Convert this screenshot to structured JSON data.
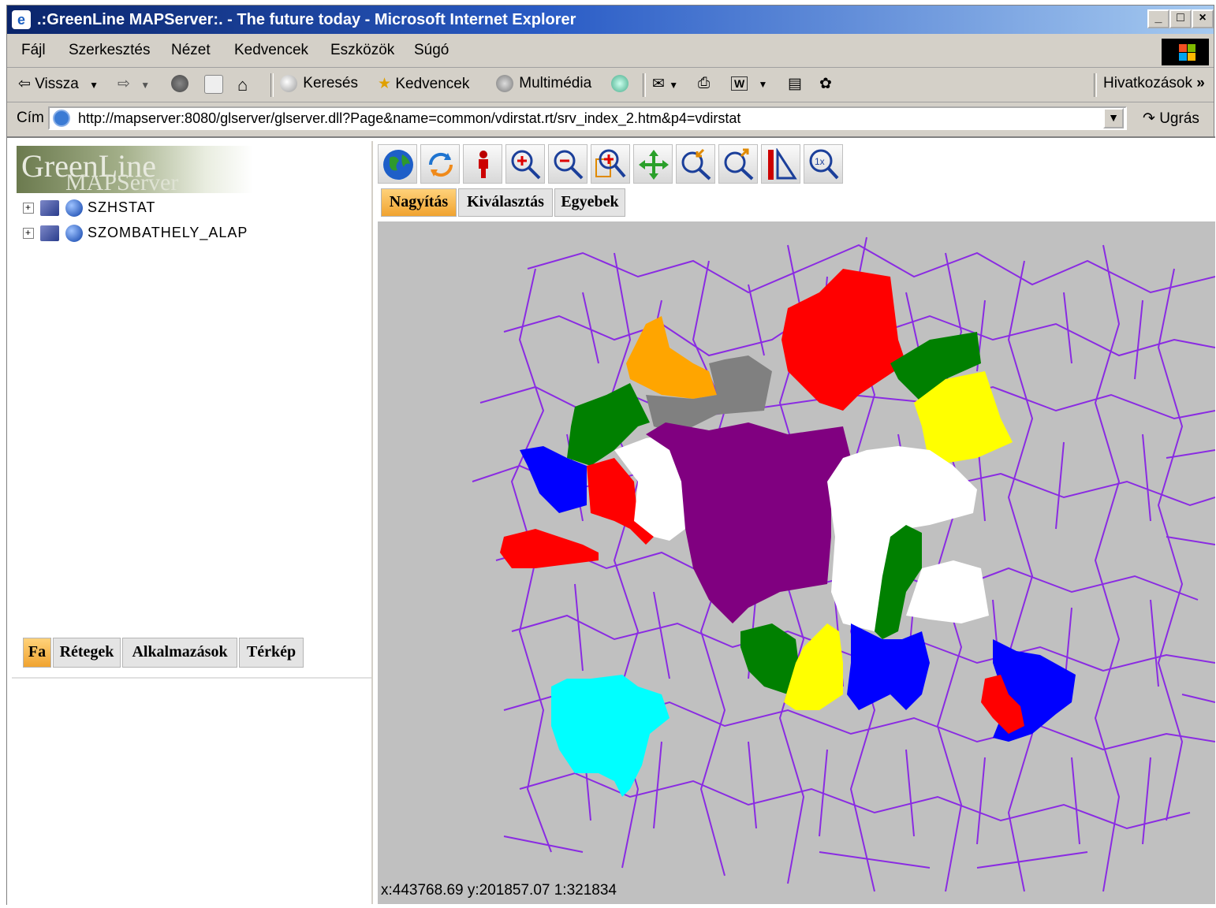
{
  "window": {
    "title": ".:GreenLine MAPServer:. - The future today - Microsoft Internet Explorer",
    "min_label": "_",
    "max_label": "□",
    "close_label": "×"
  },
  "menu": {
    "items": [
      "Fájl",
      "Szerkesztés",
      "Nézet",
      "Kedvencek",
      "Eszközök",
      "Súgó"
    ]
  },
  "toolbar": {
    "back": "Vissza",
    "search": "Keresés",
    "favorites": "Kedvencek",
    "media": "Multimédia",
    "links": "Hivatkozások",
    "links_chevron": "»"
  },
  "address": {
    "label": "Cím",
    "url": "http://mapserver:8080/glserver/glserver.dll?Page&name=common/vdirstat.rt/srv_index_2.htm&p4=vdirstat",
    "go": "Ugrás"
  },
  "logo": {
    "line1": "GreenLine",
    "line2": "MAPServer"
  },
  "tree": {
    "items": [
      {
        "label": "SZHSTAT"
      },
      {
        "label": "SZOMBATHELY_ALAP"
      }
    ]
  },
  "left_tabs": {
    "items": [
      {
        "label": "Fa"
      },
      {
        "label": "Rétegek"
      },
      {
        "label": "Alkalmazások"
      },
      {
        "label": "Térkép"
      }
    ]
  },
  "map_tools": [
    "globe-icon",
    "refresh-icon",
    "pan-figure-icon",
    "zoom-in-icon",
    "zoom-out-icon",
    "zoom-box-icon",
    "move-icon",
    "zoom-prev-icon",
    "zoom-next-icon",
    "measure-icon",
    "zoom-1x-icon"
  ],
  "map_tabs": {
    "items": [
      {
        "label": "Nagyítás"
      },
      {
        "label": "Kiválasztás"
      },
      {
        "label": "Egyebek"
      }
    ]
  },
  "map": {
    "status": "x:443768.69 y:201857.07  1:321834",
    "boundary_color": "#8a2be2",
    "background_color": "#c0c0c0",
    "region_colors": [
      "#ff0000",
      "#ffa500",
      "#808080",
      "#008000",
      "#ffff00",
      "#0000ff",
      "#ffffff",
      "#800080",
      "#00ffff"
    ]
  }
}
